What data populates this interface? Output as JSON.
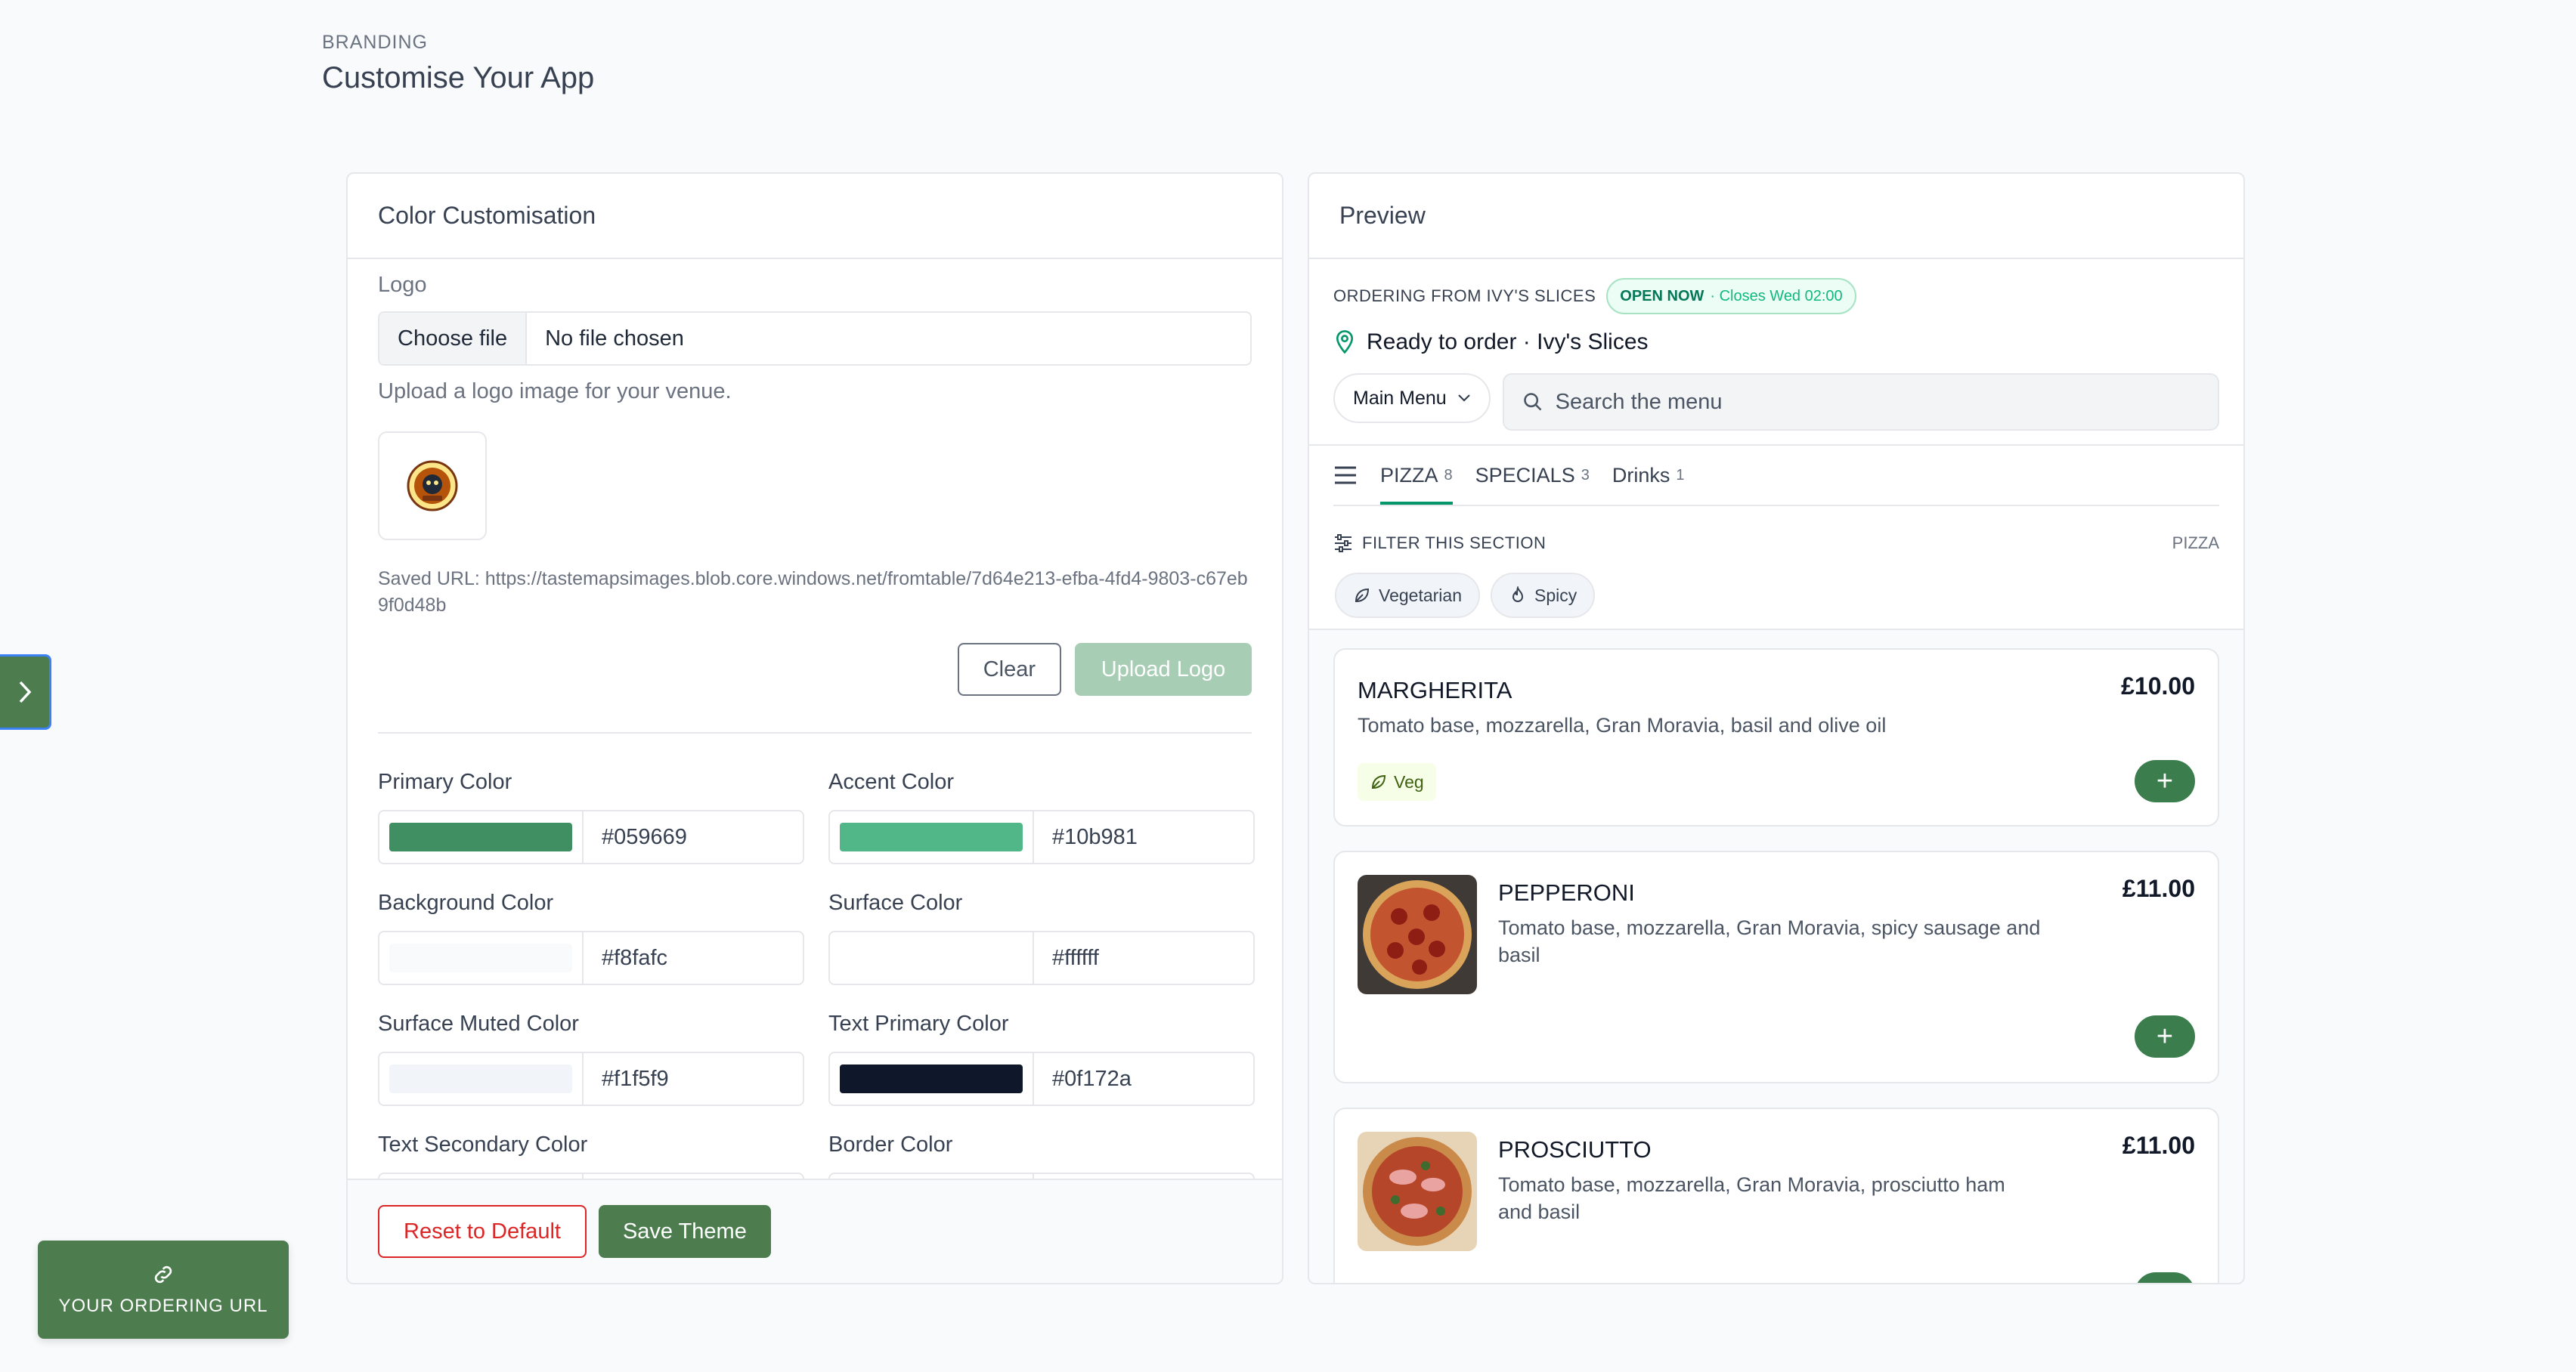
{
  "header": {
    "eyebrow": "BRANDING",
    "title": "Customise Your App"
  },
  "color_panel": {
    "title": "Color Customisation",
    "logo_label": "Logo",
    "file_button": "Choose file",
    "file_status": "No file chosen",
    "help_text": "Upload a logo image for your venue.",
    "saved_url": "Saved URL: https://tastemapsimages.blob.core.windows.net/fromtable/7d64e213-efba-4fd4-9803-c67eb9f0d48b",
    "clear_label": "Clear",
    "upload_label": "Upload Logo",
    "colors": [
      {
        "label": "Primary Color",
        "hex": "#059669",
        "swatch": "#3f8f62"
      },
      {
        "label": "Accent Color",
        "hex": "#10b981",
        "swatch": "#52b788"
      },
      {
        "label": "Background Color",
        "hex": "#f8fafc",
        "swatch": "#f8fafc"
      },
      {
        "label": "Surface Color",
        "hex": "#ffffff",
        "swatch": "#ffffff"
      },
      {
        "label": "Surface Muted Color",
        "hex": "#f1f5f9",
        "swatch": "#f1f5f9"
      },
      {
        "label": "Text Primary Color",
        "hex": "#0f172a",
        "swatch": "#0f172a"
      },
      {
        "label": "Text Secondary Color",
        "hex": "",
        "swatch": "#ffffff"
      },
      {
        "label": "Border Color",
        "hex": "",
        "swatch": "#ffffff"
      }
    ],
    "reset_label": "Reset to Default",
    "save_label": "Save Theme"
  },
  "preview": {
    "title": "Preview",
    "ordering_from": "ORDERING FROM IVY'S SLICES",
    "open_status": "OPEN NOW",
    "open_sub": "· Closes Wed 02:00",
    "ready_text": "Ready to order · Ivy's Slices",
    "menu_select": "Main Menu",
    "search_placeholder": "Search the menu",
    "tabs": [
      {
        "label": "PIZZA",
        "count": "8"
      },
      {
        "label": "SPECIALS",
        "count": "3"
      },
      {
        "label": "Drinks",
        "count": "1"
      }
    ],
    "filter_label": "FILTER THIS SECTION",
    "filter_section": "PIZZA",
    "chips": [
      "Vegetarian",
      "Spicy"
    ],
    "items": [
      {
        "name": "MARGHERITA",
        "desc": "Tomato base, mozzarella, Gran Moravia, basil and olive oil",
        "price": "£10.00",
        "badge": "Veg"
      },
      {
        "name": "PEPPERONI",
        "desc": "Tomato base, mozzarella, Gran Moravia, spicy sausage and basil",
        "price": "£11.00"
      },
      {
        "name": "PROSCIUTTO",
        "desc": "Tomato base, mozzarella, Gran Moravia, prosciutto ham and basil",
        "price": "£11.00"
      }
    ]
  },
  "ordering_url": {
    "label": "YOUR ORDERING URL"
  }
}
